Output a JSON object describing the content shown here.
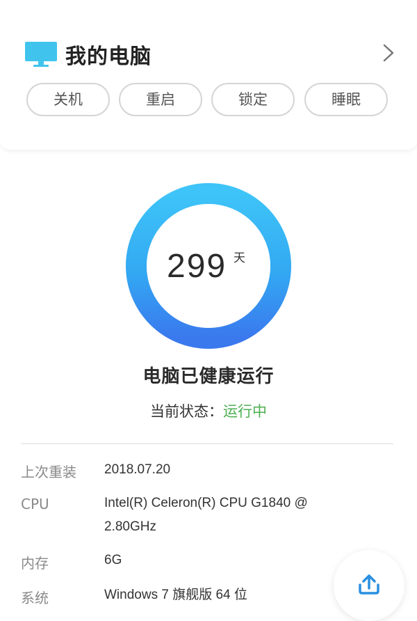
{
  "header": {
    "title": "我的电脑",
    "icon": "monitor-icon",
    "nav_icon": "chevron-right-icon"
  },
  "actions": [
    {
      "label": "关机"
    },
    {
      "label": "重启"
    },
    {
      "label": "锁定"
    },
    {
      "label": "睡眠"
    }
  ],
  "uptime": {
    "value": "299",
    "unit": "天"
  },
  "status": {
    "headline": "电脑已健康运行",
    "label": "当前状态：",
    "value": "运行中"
  },
  "info": {
    "reinstall": {
      "label": "上次重装",
      "value": "2018.07.20"
    },
    "cpu": {
      "label": "CPU",
      "value_line1": "Intel(R) Celeron(R) CPU G1840 @",
      "value_line2": "2.80GHz"
    },
    "memory": {
      "label": "内存",
      "value": "6G"
    },
    "system": {
      "label": "系统",
      "value": "Windows 7 旗舰版 64 位"
    }
  },
  "colors": {
    "accent": "#2aa9f3",
    "status_green": "#4caf50",
    "gauge_inner_stop": "#3fc6f8",
    "gauge_outer_stop": "#3a7df0"
  },
  "fab": {
    "icon": "upload-icon"
  }
}
